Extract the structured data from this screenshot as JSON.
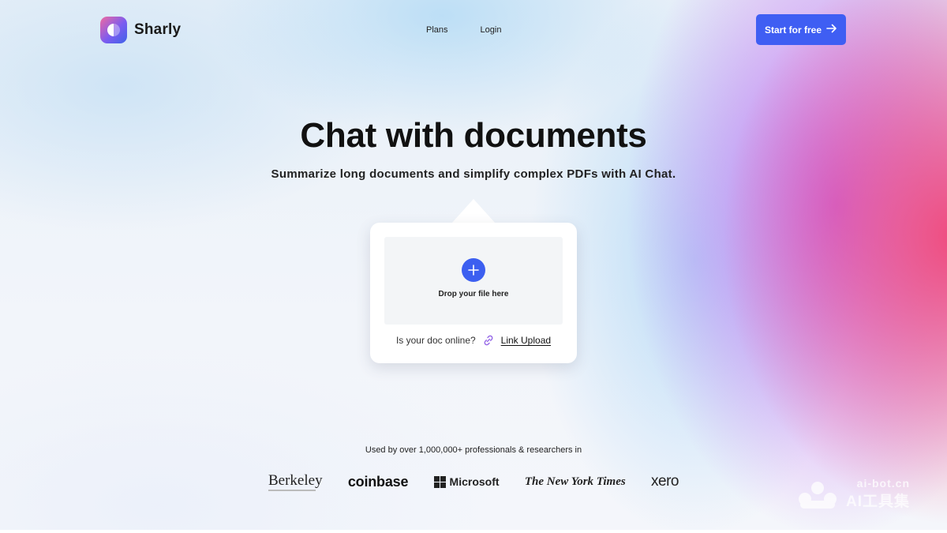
{
  "header": {
    "logo_text": "Sharly",
    "nav": [
      {
        "label": "Plans"
      },
      {
        "label": "Login"
      }
    ],
    "cta_label": "Start for free"
  },
  "hero": {
    "title": "Chat with documents",
    "subtitle": "Summarize long documents and simplify complex PDFs with AI Chat."
  },
  "upload": {
    "drop_label": "Drop your file here",
    "online_question": "Is your doc online?",
    "link_upload_label": "Link Upload"
  },
  "social_proof": {
    "text": "Used by over 1,000,000+ professionals & researchers in",
    "logos": [
      {
        "name": "Berkeley"
      },
      {
        "name": "coinbase"
      },
      {
        "name": "Microsoft"
      },
      {
        "name": "The New York Times"
      },
      {
        "name": "xero"
      }
    ]
  },
  "watermark": {
    "url": "ai-bot.cn",
    "name": "AI工具集"
  },
  "colors": {
    "accent": "#3f5ef3",
    "dropzone": "#f3f5f7"
  },
  "icons": {
    "cta": "arrow-right-icon",
    "upload": "plus-icon",
    "link": "link-icon"
  }
}
